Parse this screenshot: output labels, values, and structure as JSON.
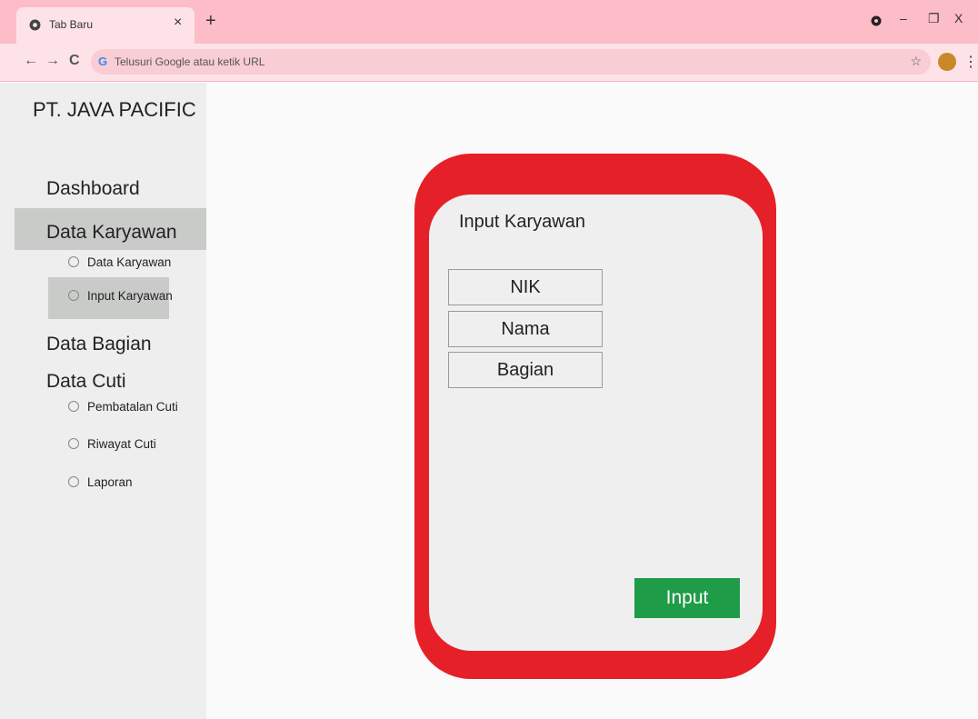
{
  "browser": {
    "tab_title": "Tab Baru",
    "tab_close": "×",
    "new_tab": "+",
    "omnibox_placeholder": "Telusuri Google atau ketik URL",
    "omnibox_icon": "G",
    "window_controls": {
      "minimize": "–",
      "restore": "❐",
      "close": "X"
    },
    "nav": {
      "back": "←",
      "forward": "→",
      "reload": "C"
    },
    "bookmark": "☆",
    "menu": "⋮"
  },
  "sidebar": {
    "company": "PT. JAVA PACIFIC",
    "dashboard": "Dashboard",
    "data_karyawan": "Data Karyawan",
    "data_karyawan_items": [
      "Data Karyawan",
      "Input Karyawan"
    ],
    "data_bagian": "Data Bagian",
    "data_cuti": "Data Cuti",
    "data_cuti_items": [
      "Pembatalan Cuti",
      "Riwayat Cuti",
      "Laporan"
    ]
  },
  "form": {
    "title": "Input Karyawan",
    "fields": [
      "NIK",
      "Nama",
      "Bagian"
    ],
    "submit": "Input"
  },
  "colors": {
    "tabbar": "#fdbdc8",
    "card_border": "#e62028",
    "submit_button": "#1f9c47",
    "sidebar_active": "#c9cbc9"
  }
}
